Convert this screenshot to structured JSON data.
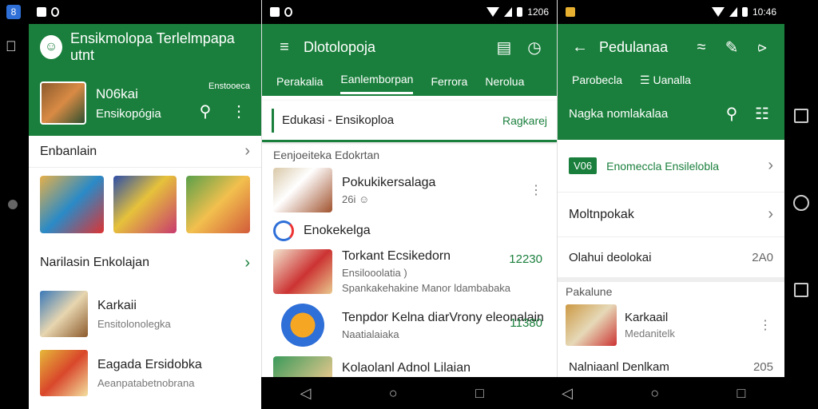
{
  "left": {
    "app_badge": "8"
  },
  "panel1": {
    "status": {
      "left": "▣ 8"
    },
    "app_title": "Ensikmolopa Terlelmpapa utnt",
    "hero": {
      "title": "N06kai",
      "subtitle": "Ensikopógia",
      "side_label": "Enstooeca"
    },
    "section1": "Enbanlain",
    "section2": "Narilasin Enkolajan",
    "items": [
      {
        "title": "Karkaii",
        "subtitle": "Ensitolonolegka"
      },
      {
        "title": "Eagada Ersidobka",
        "subtitle": "Aeanpatabetnobrana"
      }
    ]
  },
  "panel2": {
    "status": {
      "left": "▣ 8",
      "time": "1206"
    },
    "app_title": "Dlotolopoja",
    "tabs": [
      "Perakalia",
      "Eanlemborpan",
      "Ferrora",
      "Nerolua"
    ],
    "search": {
      "text": "Edukasi - Ensikoploa",
      "action": "Ragkarej"
    },
    "section_label": "Eenjoeiteka Edokrtan",
    "item1": {
      "title": "Pokukikersalaga",
      "subtitle": "26i ☺"
    },
    "category": "Enokekelga",
    "item2": {
      "title": "Torkant Ecsikedorn",
      "subtitle": "Ensilooolatia )",
      "line3": "Spankakehakine Manor ldambabaka",
      "num": "12230"
    },
    "item3": {
      "title": "Tenpdor Kelna diarVrony eleonalain",
      "subtitle": "Naatialaiaka",
      "num": "11380"
    },
    "item4": {
      "title": "Kolaolanl Adnol Lilaian"
    }
  },
  "panel3": {
    "status": {
      "time": "10:46"
    },
    "app_title": "Pedulanaa",
    "tabs": [
      "Parobecla",
      "☰ Uanalla"
    ],
    "sub_title": "Nagka nomlakalaa",
    "rows": [
      {
        "badge": "V06",
        "label": "Enomeccla Ensilelobla"
      },
      {
        "label": "Moltnpokak"
      },
      {
        "label": "Olahui deolokai",
        "value": "2A0"
      }
    ],
    "section_label": "Pakalune",
    "item1": {
      "title": "Karkaail",
      "subtitle": "Medanitelk"
    },
    "item2": {
      "title": "Nalniaanl Denlkam",
      "value": "205"
    }
  },
  "nav": {
    "back": "◁",
    "home": "○",
    "recents": "□"
  }
}
